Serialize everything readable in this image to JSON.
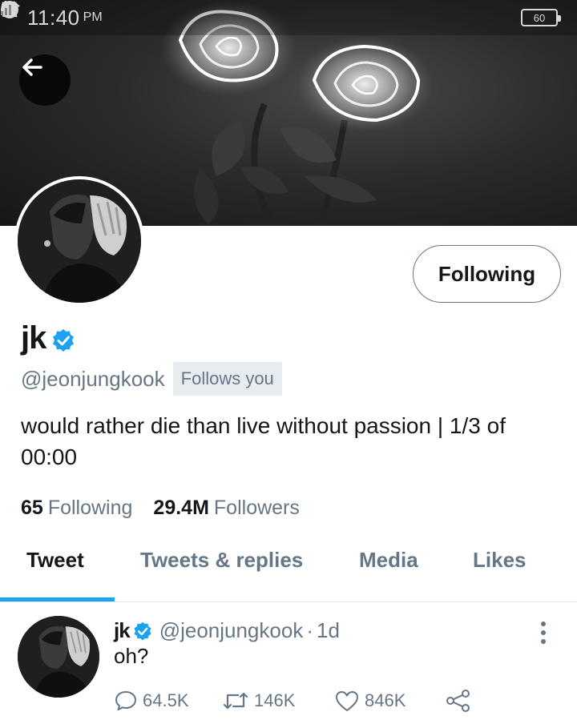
{
  "status_bar": {
    "time": "11:40",
    "ampm": "PM",
    "battery": "60"
  },
  "profile": {
    "display_name": "jk",
    "handle": "@jeonjungkook",
    "follows_you": "Follows you",
    "bio": "would rather die than live without passion | 1/3 of 00:00",
    "follow_button_label": "Following",
    "following_count": "65",
    "following_label": "Following",
    "followers_count": "29.4M",
    "followers_label": "Followers"
  },
  "tabs": [
    {
      "label": "Tweet",
      "active": true
    },
    {
      "label": "Tweets & replies",
      "active": false
    },
    {
      "label": "Media",
      "active": false
    },
    {
      "label": "Likes",
      "active": false
    }
  ],
  "tweet": {
    "name": "jk",
    "handle": "@jeonjungkook",
    "separator": "·",
    "time": "1d",
    "text": "oh?",
    "replies": "64.5K",
    "retweets": "146K",
    "likes": "846K"
  },
  "colors": {
    "accent": "#1da1f2",
    "muted": "#657786",
    "text": "#14171a",
    "badge_bg": "#e6ecf0"
  },
  "icons": {
    "back": "arrow-left-icon",
    "verified": "verified-badge-icon",
    "reply": "comment-icon",
    "retweet": "retweet-icon",
    "like": "heart-icon",
    "share": "share-icon",
    "more": "more-vertical-icon"
  }
}
